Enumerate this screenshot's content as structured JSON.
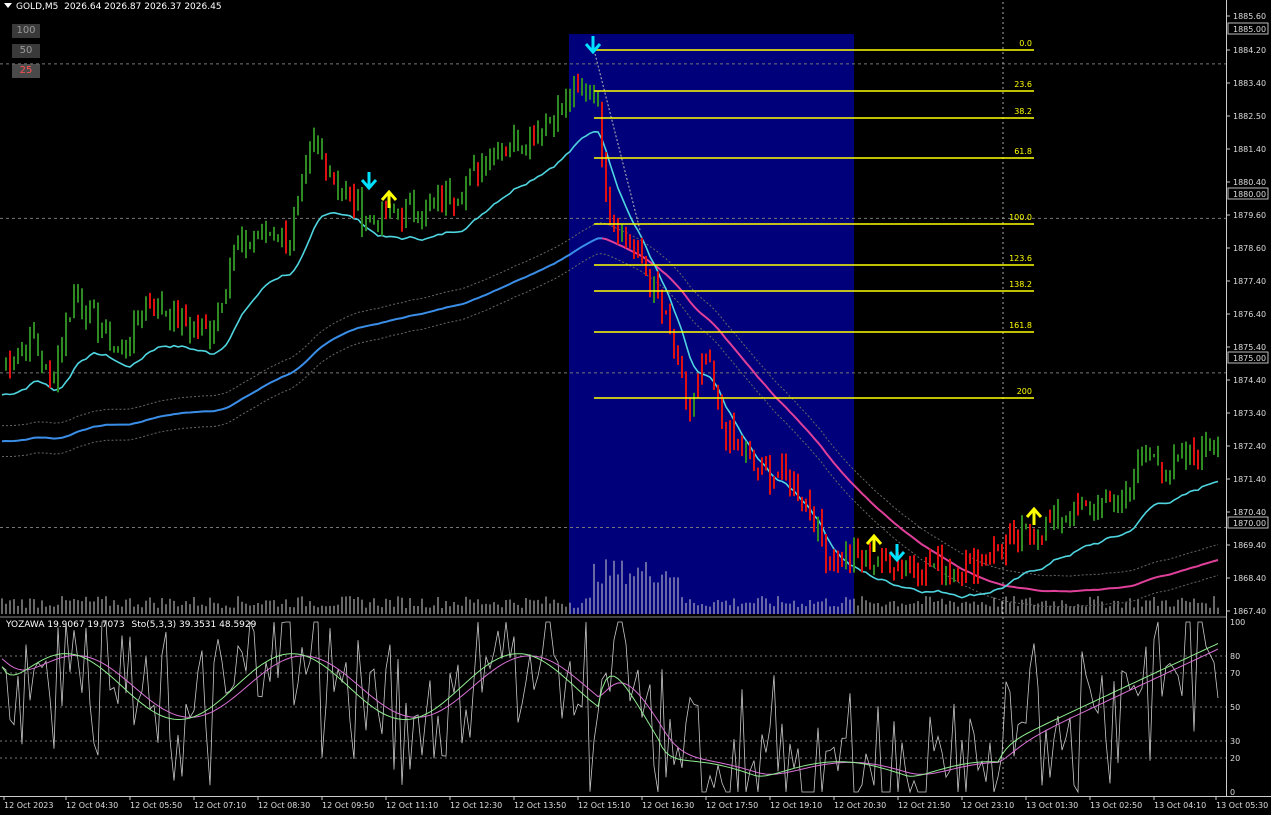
{
  "header": {
    "symbol_timeframe": "GOLD,M5",
    "ohlc": "2026.64 2026.87 2026.37 2026.45"
  },
  "level_buttons": [
    "100",
    "50",
    "25"
  ],
  "indicator": {
    "name": "YOZAWA 19.9067 19.7073",
    "stoch": "Sto(5,3,3) 39.3531 48.5929"
  },
  "price_axis": {
    "ticks": [
      "1885.60",
      "1884.20",
      "1883.40",
      "1882.50",
      "1881.40",
      "1880.40",
      "1879.60",
      "1878.60",
      "1877.40",
      "1876.40",
      "1875.40",
      "1874.40",
      "1873.40",
      "1872.40",
      "1871.40",
      "1870.40",
      "1869.40",
      "1868.40",
      "1867.40"
    ],
    "boxed": [
      "1885.00",
      "1880.00",
      "1875.00",
      "1870.00"
    ]
  },
  "stoch_axis": {
    "ticks": [
      "100",
      "80",
      "70",
      "50",
      "30",
      "20",
      "0"
    ]
  },
  "time_axis": {
    "labels": [
      "12 Oct 2023",
      "12 Oct 04:30",
      "12 Oct 05:50",
      "12 Oct 07:10",
      "12 Oct 08:30",
      "12 Oct 09:50",
      "12 Oct 11:10",
      "12 Oct 12:30",
      "12 Oct 13:50",
      "12 Oct 15:10",
      "12 Oct 16:30",
      "12 Oct 17:50",
      "12 Oct 19:10",
      "12 Oct 20:30",
      "12 Oct 21:50",
      "12 Oct 23:10",
      "13 Oct 01:30",
      "13 Oct 02:50",
      "13 Oct 04:10",
      "13 Oct 05:30"
    ]
  },
  "fibonacci": {
    "levels": [
      "0.0",
      "23.6",
      "38.2",
      "61.8",
      "100.0",
      "123.6",
      "138.2",
      "161.8",
      "200"
    ],
    "color": "#ffff00"
  },
  "colors": {
    "background": "#000000",
    "bull": "#2e8b22",
    "bear": "#e01010",
    "fast_ma": "#4fd5e0",
    "slow_ma": "#3a8ee8",
    "pink_ma": "#e0409a",
    "fib_zone": "#00007a",
    "arrow_up": "#ffff00",
    "arrow_down": "#00e0ff",
    "stoch_main": "#90ee90",
    "stoch_signal": "#da70d6",
    "yozawa": "#c8c8c8"
  }
}
